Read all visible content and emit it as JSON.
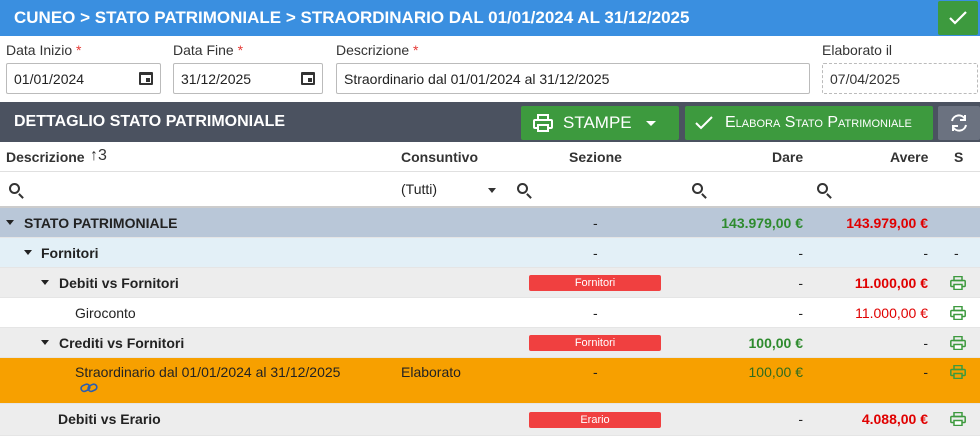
{
  "header": {
    "title": "CUNEO > STATO PATRIMONIALE > STRAORDINARIO DAL 01/01/2024 AL 31/12/2025"
  },
  "form": {
    "data_inizio": {
      "label": "Data Inizio",
      "required": "*",
      "value": "01/01/2024"
    },
    "data_fine": {
      "label": "Data Fine",
      "required": "*",
      "value": "31/12/2025"
    },
    "descrizione": {
      "label": "Descrizione",
      "required": "*",
      "value": "Straordinario dal 01/01/2024 al 31/12/2025"
    },
    "elaborato": {
      "label": "Elaborato il",
      "value": "07/04/2025"
    }
  },
  "section": {
    "title": "DETTAGLIO STATO PATRIMONIALE",
    "stampe_label": "STAMPE",
    "elabora_label": "Elabora Stato Patrimoniale"
  },
  "columns": {
    "descrizione": "Descrizione",
    "sort_indicator": "↑3",
    "consuntivo": "Consuntivo",
    "sezione": "Sezione",
    "dare": "Dare",
    "avere": "Avere",
    "s": "S"
  },
  "filters": {
    "consuntivo_value": "(Tutti)"
  },
  "rows": [
    {
      "desc": "STATO PATRIMONIALE",
      "consuntivo": "",
      "sezione": "-",
      "dare": "143.979,00 €",
      "avere": "143.979,00 €",
      "s": ""
    },
    {
      "desc": "Fornitori",
      "consuntivo": "",
      "sezione": "-",
      "dare": "-",
      "avere": "-",
      "s": "-"
    },
    {
      "desc": "Debiti vs Fornitori",
      "consuntivo": "",
      "sezione": "Fornitori",
      "dare": "-",
      "avere": "11.000,00 €",
      "s": ""
    },
    {
      "desc": "Giroconto",
      "consuntivo": "",
      "sezione": "-",
      "dare": "-",
      "avere": "11.000,00 €",
      "s": ""
    },
    {
      "desc": "Crediti vs Fornitori",
      "consuntivo": "",
      "sezione": "Fornitori",
      "dare": "100,00 €",
      "avere": "-",
      "s": ""
    },
    {
      "desc": "Straordinario dal 01/01/2024 al 31/12/2025",
      "consuntivo": "Elaborato",
      "sezione": "-",
      "dare": "100,00 €",
      "avere": "-",
      "s": ""
    },
    {
      "desc": "Debiti vs Erario",
      "consuntivo": "",
      "sezione": "Erario",
      "dare": "-",
      "avere": "4.088,00 €",
      "s": ""
    }
  ],
  "colors": {
    "header_blue": "#3a8fe0",
    "button_green": "#3d9a3e",
    "section_dark": "#4b5260",
    "highlight_orange": "#f7a000",
    "badge_red": "#f04040"
  }
}
